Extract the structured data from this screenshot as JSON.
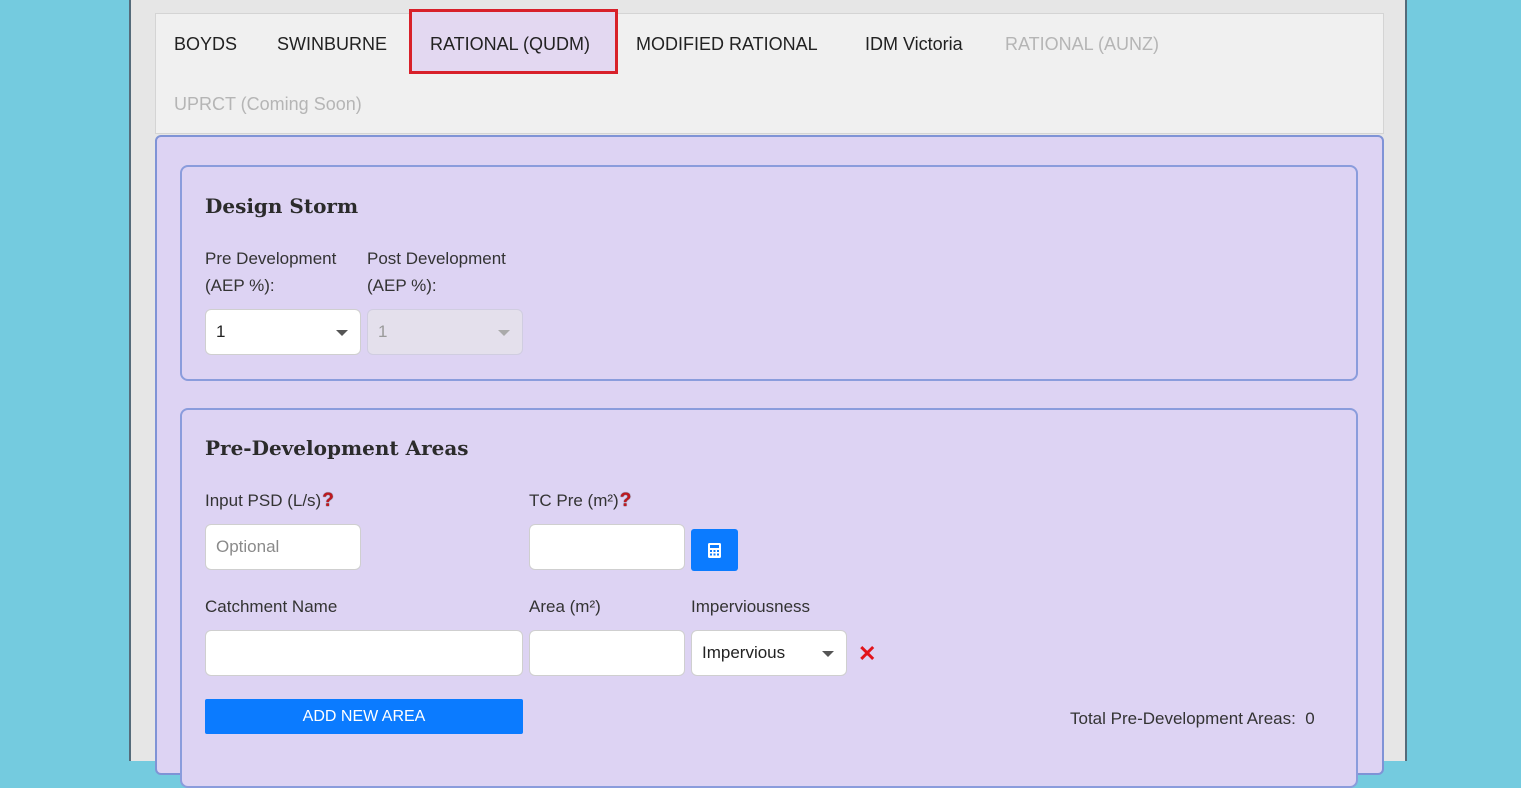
{
  "tabs": [
    {
      "label": "BOYDS",
      "state": "normal"
    },
    {
      "label": "SWINBURNE",
      "state": "normal"
    },
    {
      "label": "RATIONAL (QUDM)",
      "state": "active"
    },
    {
      "label": "MODIFIED RATIONAL",
      "state": "normal"
    },
    {
      "label": "IDM Victoria",
      "state": "normal"
    },
    {
      "label": "RATIONAL (AUNZ)",
      "state": "disabled"
    },
    {
      "label": "UPRCT (Coming Soon)",
      "state": "disabled"
    }
  ],
  "design_storm": {
    "title": "Design Storm",
    "pre_label_line1": "Pre Development",
    "pre_label_line2": "(AEP %):",
    "pre_value": "1",
    "post_label_line1": "Post Development",
    "post_label_line2": "(AEP %):",
    "post_value": "1"
  },
  "pre_dev": {
    "title": "Pre-Development Areas",
    "psd_label": "Input PSD (L/s)",
    "psd_placeholder": "Optional",
    "tc_label": "TC Pre (m²)",
    "help_glyph": "?",
    "catchment_label": "Catchment Name",
    "area_label": "Area (m²)",
    "impervious_label": "Imperviousness",
    "impervious_value": "Impervious",
    "remove_glyph": "✕",
    "add_button": "ADD NEW AREA",
    "total_label": "Total Pre-Development Areas:",
    "total_value": "0"
  },
  "colors": {
    "accent_blue": "#0b7bff",
    "active_outline": "#d8202a",
    "form_bg": "#ddd3f3"
  }
}
